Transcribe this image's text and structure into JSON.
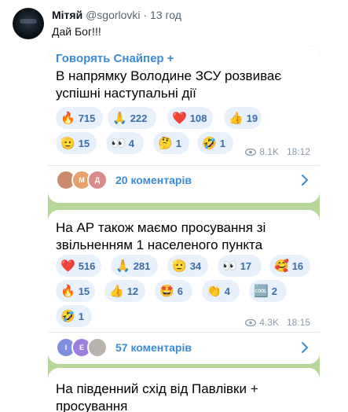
{
  "tweet": {
    "author": "Мітяй",
    "handle": "@sgorlovki",
    "separator": "·",
    "time": "13 год",
    "text": "Дай Бог!!!"
  },
  "telegram": {
    "background_color": "#b7d79a",
    "accent_color": "#3a8bd8",
    "posts": [
      {
        "channel": "Говорять Снайпер",
        "channel_badge": "+",
        "text": "В напрямку Володине ЗСУ розвиває успішні наступальні дії",
        "reactions": [
          {
            "emoji": "🔥",
            "count": "715"
          },
          {
            "emoji": "🙏",
            "count": "222"
          },
          {
            "emoji": "❤️",
            "count": "108"
          },
          {
            "emoji": "👍",
            "count": "19"
          },
          {
            "emoji": "🫡",
            "count": "15"
          },
          {
            "emoji": "👀",
            "count": "4"
          },
          {
            "emoji": "🤔",
            "count": "1"
          },
          {
            "emoji": "🤣",
            "count": "1"
          }
        ],
        "views": "8.1K",
        "time": "18:12",
        "comments": "20 коментарів",
        "commenter_initials": [
          "",
          "М",
          "Д"
        ]
      },
      {
        "text": "На АР також маємо просування зі звільненням 1 населеного пункта",
        "reactions": [
          {
            "emoji": "❤️",
            "count": "516"
          },
          {
            "emoji": "🙏",
            "count": "281"
          },
          {
            "emoji": "🫡",
            "count": "34"
          },
          {
            "emoji": "👀",
            "count": "17"
          },
          {
            "emoji": "🥰",
            "count": "16"
          },
          {
            "emoji": "🔥",
            "count": "15"
          },
          {
            "emoji": "👍",
            "count": "12"
          },
          {
            "emoji": "🤩",
            "count": "6"
          },
          {
            "emoji": "👏",
            "count": "4"
          },
          {
            "emoji": "🆒",
            "count": "2"
          },
          {
            "emoji": "🤣",
            "count": "1"
          }
        ],
        "views": "4.3K",
        "time": "18:15",
        "comments": "57 коментарів",
        "commenter_initials": [
          "І",
          "Е",
          ""
        ]
      },
      {
        "text": "На південний схід від Павлівки + просування"
      }
    ]
  },
  "icons": {
    "views": "eye-icon",
    "comments_arrow": "chevron-right-icon"
  }
}
